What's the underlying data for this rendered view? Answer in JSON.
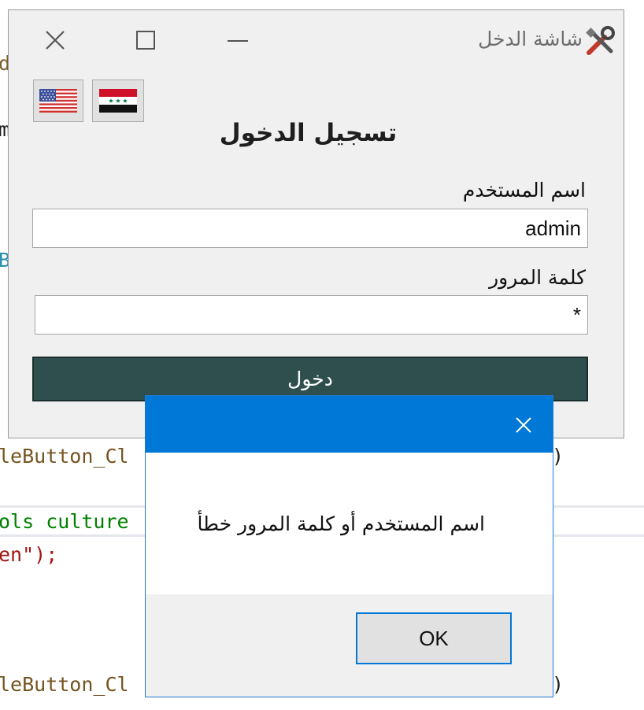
{
  "background_code": {
    "lines": [
      {
        "text": "d",
        "color": "#795e26"
      },
      {
        "text": "m",
        "color": "#1e1e1e"
      },
      {
        "text": "B",
        "color": "#2b91af"
      },
      {
        "text": "leButton_Cl",
        "color": "#74531f",
        "suffix": "e)"
      },
      {
        "text": "ols culture",
        "color": "#008000"
      },
      {
        "text": "en\");",
        "color": "#a31515"
      },
      {
        "text": "leButton_Cl",
        "color": "#74531f",
        "suffix": "e)"
      }
    ]
  },
  "window": {
    "title": "شاشة الدخل",
    "title_icon": "tools-icon",
    "controls": {
      "minimize": "minimize-icon",
      "maximize": "maximize-icon",
      "close": "close-icon"
    },
    "flags": [
      {
        "name": "iraq-flag",
        "language": "ar"
      },
      {
        "name": "us-flag",
        "language": "en"
      }
    ],
    "heading": "تسجيل الدخول",
    "username_label": "اسم المستخدم",
    "username_value": "admin",
    "password_label": "كلمة المرور",
    "password_value": "*",
    "login_button": "دخول",
    "accent": "#2f4f4f"
  },
  "message_box": {
    "message": "اسم المستخدم أو كلمة المرور خطأ",
    "ok_label": "OK",
    "close_icon": "close-icon",
    "title_bar_color": "#0078d7"
  }
}
